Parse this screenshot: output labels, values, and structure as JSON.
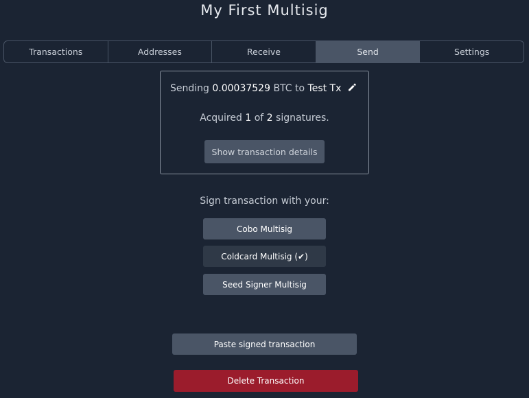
{
  "header": {
    "title": "My First Multisig"
  },
  "tabs": [
    {
      "label": "Transactions",
      "active": false
    },
    {
      "label": "Addresses",
      "active": false
    },
    {
      "label": "Receive",
      "active": false
    },
    {
      "label": "Send",
      "active": true
    },
    {
      "label": "Settings",
      "active": false
    }
  ],
  "summary": {
    "sending_prefix": "Sending",
    "amount": "0.00037529",
    "unit": "BTC to",
    "label": "Test Tx",
    "acquired_prefix": "Acquired",
    "acquired_count": "1",
    "of_word": "of",
    "required_count": "2",
    "signatures_suffix": "signatures.",
    "details_button": "Show transaction details"
  },
  "signing": {
    "prompt": "Sign transaction with your:",
    "signers": [
      {
        "label": "Cobo Multisig",
        "signed": false
      },
      {
        "label": "Coldcard Multisig (✔)",
        "signed": true
      },
      {
        "label": "Seed Signer Multisig",
        "signed": false
      }
    ]
  },
  "actions": {
    "paste_label": "Paste signed transaction",
    "delete_label": "Delete Transaction"
  },
  "colors": {
    "background": "#1b2433",
    "button": "#4a5566",
    "danger": "#9b1c2c"
  }
}
